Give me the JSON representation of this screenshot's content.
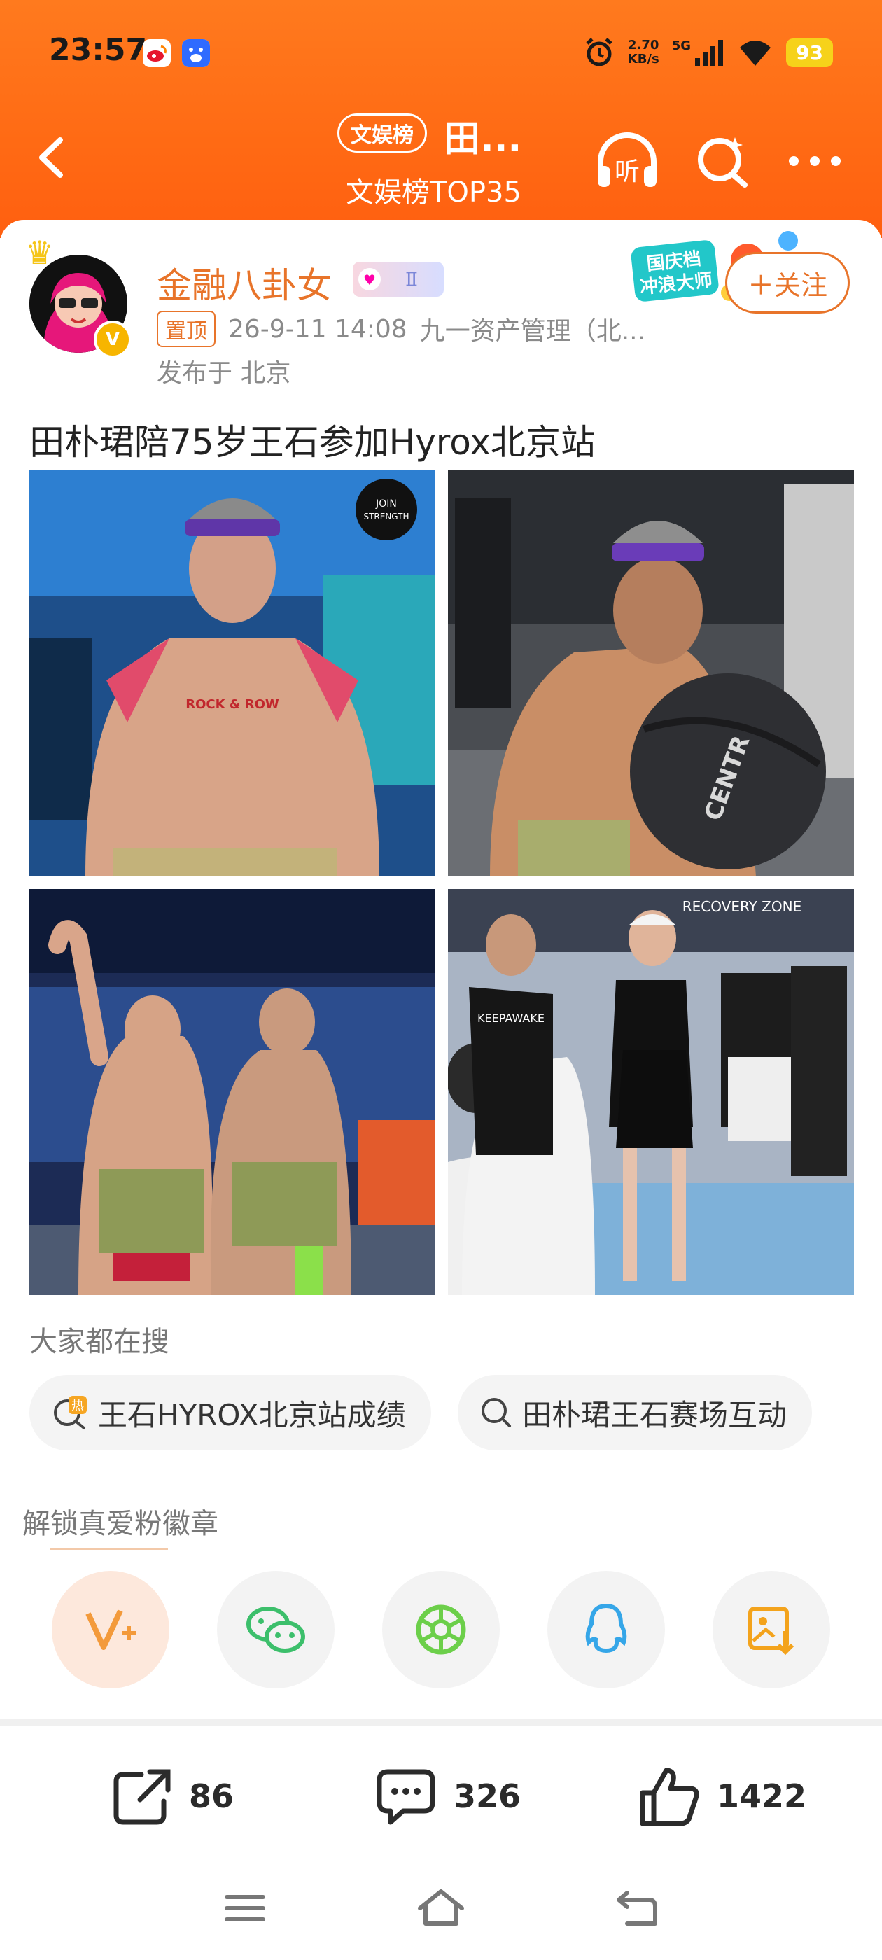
{
  "status_bar": {
    "time": "23:57",
    "net_speed_value": "2.70",
    "net_speed_unit": "KB/s",
    "network_type": "5G",
    "battery": "93"
  },
  "nav": {
    "badge": "文娱榜",
    "title": "田...",
    "subtitle": "文娱榜TOP35",
    "listen_label": "听"
  },
  "post": {
    "username": "金融八卦女",
    "member_badge": "Ⅱ",
    "pinned_label": "置顶",
    "timestamp": "26-9-11 14:08",
    "source": "九一资产管理（北...",
    "location": "发布于 北京",
    "follow_label": "＋关注",
    "title": "田朴珺陪75岁王石参加Hyrox北京站",
    "promo_line1": "国庆档",
    "promo_line2": "冲浪大师",
    "photos": [
      {
        "badge_line1": "JOIN",
        "badge_line2": "STRENGTH",
        "chest_text": "ROCK & ROW"
      },
      {
        "ball_text": "CENTR"
      },
      {},
      {
        "banner_text": "RECOVERY ZONE",
        "shirt_text": "KEEPAWAKE"
      }
    ]
  },
  "searches": {
    "label": "大家都在搜",
    "items": [
      {
        "text": "王石HYROX北京站成绩",
        "tag": "热"
      },
      {
        "text": "田朴珺王石赛场互动"
      }
    ]
  },
  "unlock_label": "解锁真爱粉徽章",
  "actions": {
    "share_count": "86",
    "comment_count": "326",
    "like_count": "1422"
  },
  "colors": {
    "header": "#ff6a14",
    "accent": "#e8742a"
  }
}
